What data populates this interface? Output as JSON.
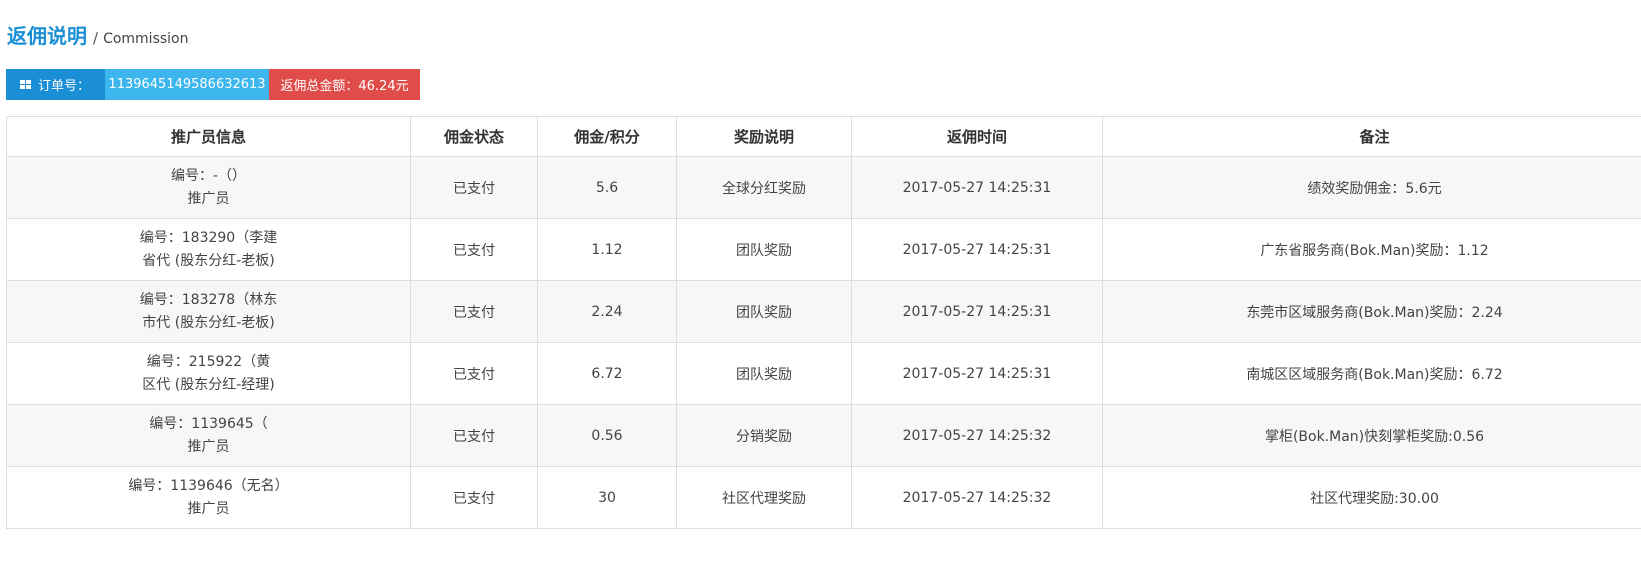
{
  "header": {
    "title": "返佣说明",
    "separator": "/",
    "subtitle": "Commission"
  },
  "order": {
    "label": "订单号：",
    "number": "1139645149586632613",
    "total": "返佣总金额：46.24元",
    "label_icon": "grid-icon",
    "colors": {
      "label_bg": "#1b8fd6",
      "number_bg": "#3db6ee",
      "total_bg": "#df4c49"
    }
  },
  "table": {
    "headers": [
      "推广员信息",
      "佣金状态",
      "佣金/积分",
      "奖励说明",
      "返佣时间",
      "备注"
    ],
    "rows": [
      {
        "promoter_line1": "编号：-（）",
        "promoter_line2": "推广员",
        "status": "已支付",
        "amount": "5.6",
        "reward": "全球分红奖励",
        "time": "2017-05-27 14:25:31",
        "remark": "绩效奖励佣金：5.6元"
      },
      {
        "promoter_line1": "编号：183290（李建",
        "promoter_line2": "省代 (股东分红-老板)",
        "status": "已支付",
        "amount": "1.12",
        "reward": "团队奖励",
        "time": "2017-05-27 14:25:31",
        "remark": "广东省服务商(Bok.Man)奖励：1.12"
      },
      {
        "promoter_line1": "编号：183278（林东",
        "promoter_line2": "市代 (股东分红-老板)",
        "status": "已支付",
        "amount": "2.24",
        "reward": "团队奖励",
        "time": "2017-05-27 14:25:31",
        "remark": "东莞市区域服务商(Bok.Man)奖励：2.24"
      },
      {
        "promoter_line1": "编号：215922（黄",
        "promoter_line2": "区代 (股东分红-经理)",
        "status": "已支付",
        "amount": "6.72",
        "reward": "团队奖励",
        "time": "2017-05-27 14:25:31",
        "remark": "南城区区域服务商(Bok.Man)奖励：6.72"
      },
      {
        "promoter_line1": "编号：1139645（",
        "promoter_line2": "推广员",
        "status": "已支付",
        "amount": "0.56",
        "reward": "分销奖励",
        "time": "2017-05-27 14:25:32",
        "remark": "掌柜(Bok.Man)快刻掌柜奖励:0.56"
      },
      {
        "promoter_line1": "编号：1139646（无名）",
        "promoter_line2": "推广员",
        "status": "已支付",
        "amount": "30",
        "reward": "社区代理奖励",
        "time": "2017-05-27 14:25:32",
        "remark": "社区代理奖励:30.00"
      }
    ]
  }
}
